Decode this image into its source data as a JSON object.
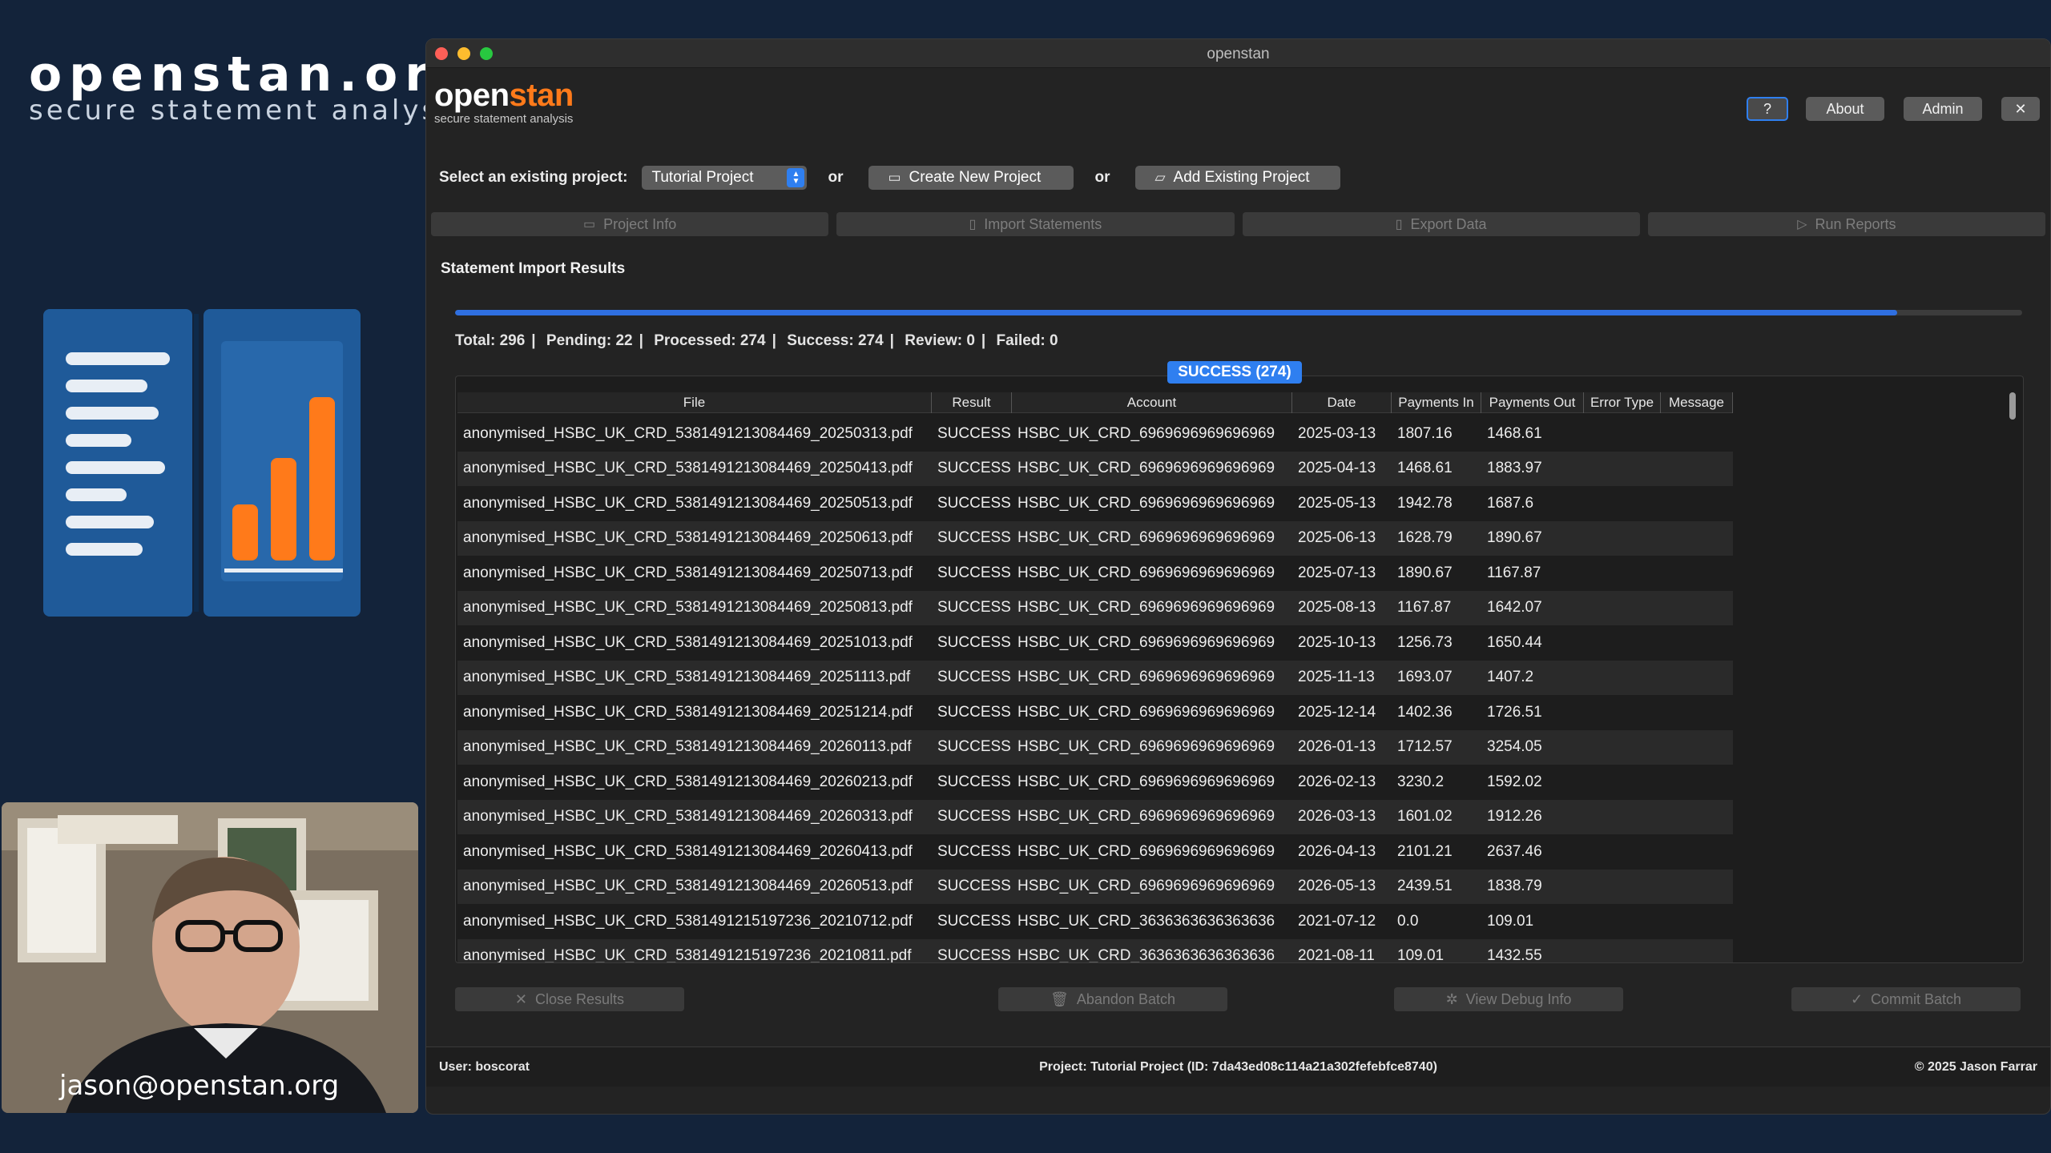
{
  "brand": {
    "title": "openstan.org",
    "subtitle": "secure statement analysis"
  },
  "webcam": {
    "email": "jason@openstan.org"
  },
  "window": {
    "title": "openstan",
    "logo_open": "open",
    "logo_stan": "stan",
    "logo_tagline": "secure statement analysis"
  },
  "top_buttons": {
    "help": "?",
    "about": "About",
    "admin": "Admin",
    "close": "✕"
  },
  "project": {
    "label": "Select an existing project:",
    "selected": "Tutorial Project",
    "or": "or",
    "create": "Create New Project",
    "add": "Add Existing Project"
  },
  "tabs": [
    {
      "label": "Project Info"
    },
    {
      "label": "Import Statements"
    },
    {
      "label": "Export Data"
    },
    {
      "label": "Run Reports"
    }
  ],
  "section_title": "Statement Import Results",
  "progress": {
    "fraction": 0.92
  },
  "stats": {
    "total": "Total: 296",
    "pending": "Pending: 22",
    "processed": "Processed: 274",
    "success": "Success: 274",
    "review": "Review: 0",
    "failed": "Failed: 0"
  },
  "filter_badge": "SUCCESS (274)",
  "table": {
    "headers": [
      "File",
      "Result",
      "Account",
      "Date",
      "Payments In",
      "Payments Out",
      "Error Type",
      "Message"
    ],
    "rows": [
      [
        "anonymised_HSBC_UK_CRD_5381491213084469_20250313.pdf",
        "SUCCESS",
        "HSBC_UK_CRD_6969696969696969",
        "2025-03-13",
        "1807.16",
        "1468.61"
      ],
      [
        "anonymised_HSBC_UK_CRD_5381491213084469_20250413.pdf",
        "SUCCESS",
        "HSBC_UK_CRD_6969696969696969",
        "2025-04-13",
        "1468.61",
        "1883.97"
      ],
      [
        "anonymised_HSBC_UK_CRD_5381491213084469_20250513.pdf",
        "SUCCESS",
        "HSBC_UK_CRD_6969696969696969",
        "2025-05-13",
        "1942.78",
        "1687.6"
      ],
      [
        "anonymised_HSBC_UK_CRD_5381491213084469_20250613.pdf",
        "SUCCESS",
        "HSBC_UK_CRD_6969696969696969",
        "2025-06-13",
        "1628.79",
        "1890.67"
      ],
      [
        "anonymised_HSBC_UK_CRD_5381491213084469_20250713.pdf",
        "SUCCESS",
        "HSBC_UK_CRD_6969696969696969",
        "2025-07-13",
        "1890.67",
        "1167.87"
      ],
      [
        "anonymised_HSBC_UK_CRD_5381491213084469_20250813.pdf",
        "SUCCESS",
        "HSBC_UK_CRD_6969696969696969",
        "2025-08-13",
        "1167.87",
        "1642.07"
      ],
      [
        "anonymised_HSBC_UK_CRD_5381491213084469_20251013.pdf",
        "SUCCESS",
        "HSBC_UK_CRD_6969696969696969",
        "2025-10-13",
        "1256.73",
        "1650.44"
      ],
      [
        "anonymised_HSBC_UK_CRD_5381491213084469_20251113.pdf",
        "SUCCESS",
        "HSBC_UK_CRD_6969696969696969",
        "2025-11-13",
        "1693.07",
        "1407.2"
      ],
      [
        "anonymised_HSBC_UK_CRD_5381491213084469_20251214.pdf",
        "SUCCESS",
        "HSBC_UK_CRD_6969696969696969",
        "2025-12-14",
        "1402.36",
        "1726.51"
      ],
      [
        "anonymised_HSBC_UK_CRD_5381491213084469_20260113.pdf",
        "SUCCESS",
        "HSBC_UK_CRD_6969696969696969",
        "2026-01-13",
        "1712.57",
        "3254.05"
      ],
      [
        "anonymised_HSBC_UK_CRD_5381491213084469_20260213.pdf",
        "SUCCESS",
        "HSBC_UK_CRD_6969696969696969",
        "2026-02-13",
        "3230.2",
        "1592.02"
      ],
      [
        "anonymised_HSBC_UK_CRD_5381491213084469_20260313.pdf",
        "SUCCESS",
        "HSBC_UK_CRD_6969696969696969",
        "2026-03-13",
        "1601.02",
        "1912.26"
      ],
      [
        "anonymised_HSBC_UK_CRD_5381491213084469_20260413.pdf",
        "SUCCESS",
        "HSBC_UK_CRD_6969696969696969",
        "2026-04-13",
        "2101.21",
        "2637.46"
      ],
      [
        "anonymised_HSBC_UK_CRD_5381491213084469_20260513.pdf",
        "SUCCESS",
        "HSBC_UK_CRD_6969696969696969",
        "2026-05-13",
        "2439.51",
        "1838.79"
      ],
      [
        "anonymised_HSBC_UK_CRD_5381491215197236_20210712.pdf",
        "SUCCESS",
        "HSBC_UK_CRD_3636363636363636",
        "2021-07-12",
        "0.0",
        "109.01"
      ],
      [
        "anonymised_HSBC_UK_CRD_5381491215197236_20210811.pdf",
        "SUCCESS",
        "HSBC_UK_CRD_3636363636363636",
        "2021-08-11",
        "109.01",
        "1432.55"
      ]
    ]
  },
  "actions": {
    "close_results": "Close Results",
    "abandon_batch": "Abandon Batch",
    "view_debug": "View Debug Info",
    "commit_batch": "Commit Batch"
  },
  "statusbar": {
    "user": "User: boscorat",
    "project": "Project: Tutorial Project (ID: 7da43ed08c114a21a302fefebfce8740)",
    "copyright": "© 2025 Jason Farrar"
  },
  "colors": {
    "accent": "#2f7ff0",
    "brand_orange": "#ff7a1a",
    "background": "#13233a"
  }
}
